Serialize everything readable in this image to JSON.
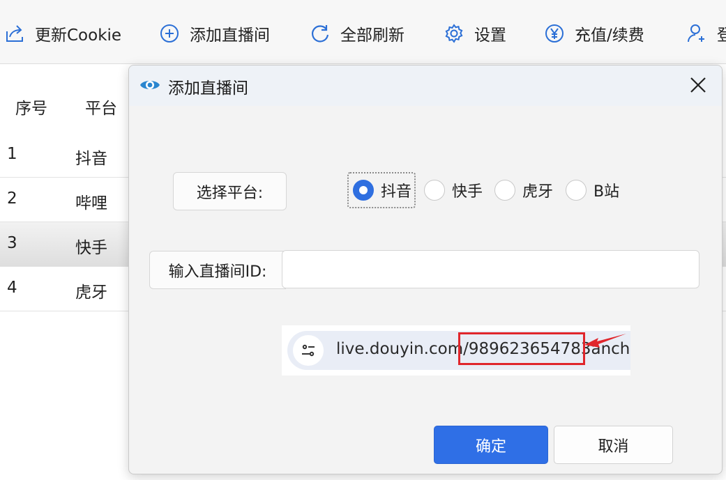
{
  "toolbar": {
    "items": [
      {
        "label": "更新Cookie",
        "icon": "share-arrow-icon"
      },
      {
        "label": "添加直播间",
        "icon": "plus-circle-icon"
      },
      {
        "label": "全部刷新",
        "icon": "refresh-icon"
      },
      {
        "label": "设置",
        "icon": "gear-icon"
      },
      {
        "label": "充值/续费",
        "icon": "yen-circle-icon"
      },
      {
        "label": "登",
        "icon": "add-user-icon"
      }
    ]
  },
  "table": {
    "headers": [
      "序号",
      "平台"
    ],
    "rows": [
      {
        "index": "1",
        "platform": "抖音"
      },
      {
        "index": "2",
        "platform": "哔哩"
      },
      {
        "index": "3",
        "platform": "快手"
      },
      {
        "index": "4",
        "platform": "虎牙"
      }
    ],
    "selected_row": "3"
  },
  "dialog": {
    "title": "添加直播间",
    "platform_label": "选择平台:",
    "platforms": [
      "抖音",
      "快手",
      "虎牙",
      "B站"
    ],
    "selected_platform": "抖音",
    "id_label": "输入直播间ID:",
    "id_value": "",
    "hint": {
      "url_prefix": "live.douyin.com/",
      "room_id": "989623654783",
      "url_suffix": "ancho"
    },
    "ok_label": "确定",
    "cancel_label": "取消"
  },
  "colors": {
    "accent": "#2f6fe0",
    "highlight_red": "#e0262c"
  }
}
